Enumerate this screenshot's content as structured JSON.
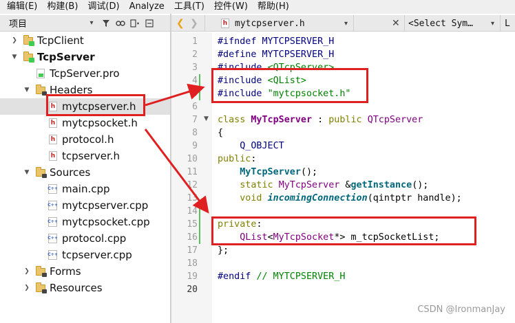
{
  "menubar": {
    "items": [
      "编辑(E)",
      "构建(B)",
      "调试(D)",
      "Analyze",
      "工具(T)",
      "控件(W)",
      "帮助(H)"
    ]
  },
  "left_panel": {
    "title": "项目"
  },
  "tree": {
    "items": [
      {
        "label": "TcpClient",
        "kind": "project",
        "bold": false
      },
      {
        "label": "TcpServer",
        "kind": "project",
        "bold": true
      },
      {
        "label": "TcpServer.pro",
        "kind": "pro",
        "bold": false
      },
      {
        "label": "Headers",
        "kind": "folder",
        "bold": false
      },
      {
        "label": "mytcpserver.h",
        "kind": "h",
        "bold": false,
        "selected": true
      },
      {
        "label": "mytcpsocket.h",
        "kind": "h",
        "bold": false
      },
      {
        "label": "protocol.h",
        "kind": "h",
        "bold": false
      },
      {
        "label": "tcpserver.h",
        "kind": "h",
        "bold": false
      },
      {
        "label": "Sources",
        "kind": "folder",
        "bold": false
      },
      {
        "label": "main.cpp",
        "kind": "cpp",
        "bold": false
      },
      {
        "label": "mytcpserver.cpp",
        "kind": "cpp",
        "bold": false
      },
      {
        "label": "mytcpsocket.cpp",
        "kind": "cpp",
        "bold": false
      },
      {
        "label": "protocol.cpp",
        "kind": "cpp",
        "bold": false
      },
      {
        "label": "tcpserver.cpp",
        "kind": "cpp",
        "bold": false
      },
      {
        "label": "Forms",
        "kind": "folder",
        "bold": false
      },
      {
        "label": "Resources",
        "kind": "folder",
        "bold": false
      }
    ]
  },
  "editor": {
    "file_name": "mytcpserver.h",
    "file_icon": "h",
    "symbol_placeholder": "<Select Sym…",
    "extra": "L"
  },
  "code": {
    "current_line": 20,
    "lines": [
      {
        "n": "1",
        "tokens": [
          [
            "pre",
            "#ifndef "
          ],
          [
            "macro",
            "MYTCPSERVER_H"
          ]
        ]
      },
      {
        "n": "2",
        "tokens": [
          [
            "pre",
            "#define "
          ],
          [
            "macro",
            "MYTCPSERVER_H"
          ]
        ]
      },
      {
        "n": "3",
        "tokens": [
          [
            "pre",
            "#include "
          ],
          [
            "str",
            "<QTcpServer>"
          ]
        ]
      },
      {
        "n": "4",
        "tokens": [
          [
            "pre",
            "#include "
          ],
          [
            "str",
            "<QList>"
          ]
        ]
      },
      {
        "n": "5",
        "tokens": [
          [
            "pre",
            "#include "
          ],
          [
            "str",
            "\"mytcpsocket.h\""
          ]
        ]
      },
      {
        "n": "6",
        "tokens": []
      },
      {
        "n": "7",
        "tokens": [
          [
            "kw",
            "class "
          ],
          [
            "cls",
            "MyTcpServer"
          ],
          [
            "plain",
            " : "
          ],
          [
            "kw",
            "public "
          ],
          [
            "type",
            "QTcpServer"
          ]
        ]
      },
      {
        "n": "8",
        "tokens": [
          [
            "plain",
            "{"
          ]
        ]
      },
      {
        "n": "9",
        "tokens": [
          [
            "plain",
            "    "
          ],
          [
            "pre",
            "Q_OBJECT"
          ]
        ]
      },
      {
        "n": "10",
        "tokens": [
          [
            "kw",
            "public"
          ],
          [
            "plain",
            ":"
          ]
        ]
      },
      {
        "n": "11",
        "tokens": [
          [
            "plain",
            "    "
          ],
          [
            "fn",
            "MyTcpServer"
          ],
          [
            "plain",
            "();"
          ]
        ]
      },
      {
        "n": "12",
        "tokens": [
          [
            "plain",
            "    "
          ],
          [
            "kw",
            "static "
          ],
          [
            "type",
            "MyTcpServer"
          ],
          [
            "plain",
            " &"
          ],
          [
            "fn",
            "getInstance"
          ],
          [
            "plain",
            "();"
          ]
        ]
      },
      {
        "n": "13",
        "tokens": [
          [
            "plain",
            "    "
          ],
          [
            "kw",
            "void "
          ],
          [
            "virt",
            "incomingConnection"
          ],
          [
            "plain",
            "(qintptr handle);"
          ]
        ]
      },
      {
        "n": "14",
        "tokens": []
      },
      {
        "n": "15",
        "tokens": [
          [
            "kw",
            "private"
          ],
          [
            "plain",
            ":"
          ]
        ]
      },
      {
        "n": "16",
        "tokens": [
          [
            "plain",
            "    "
          ],
          [
            "type",
            "QList"
          ],
          [
            "plain",
            "<"
          ],
          [
            "type",
            "MyTcpSocket"
          ],
          [
            "plain",
            "*> m_tcpSocketList;"
          ]
        ]
      },
      {
        "n": "17",
        "tokens": [
          [
            "plain",
            "};"
          ]
        ]
      },
      {
        "n": "18",
        "tokens": []
      },
      {
        "n": "19",
        "tokens": [
          [
            "pre",
            "#endif "
          ],
          [
            "com",
            "// MYTCPSERVER_H"
          ]
        ]
      },
      {
        "n": "20",
        "tokens": []
      }
    ]
  },
  "watermark": "CSDN @IronmanJay",
  "colors": {
    "annotation_red": "#e02020",
    "change_marker": "#57c15b",
    "preprocessor": "#000080",
    "string": "#008000",
    "keyword": "#808000",
    "type": "#800080",
    "function": "#00677c"
  }
}
